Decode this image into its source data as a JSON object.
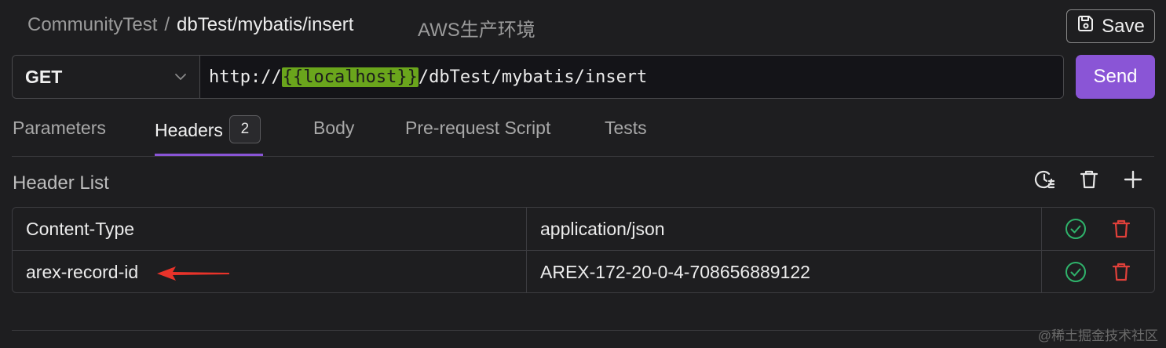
{
  "breadcrumb": {
    "workspace": "CommunityTest",
    "separator": "/",
    "path": "dbTest/mybatis/insert"
  },
  "environment": "AWS生产环境",
  "toolbar": {
    "save_label": "Save"
  },
  "request": {
    "method": "GET",
    "url_prefix": "http://",
    "url_variable": "{{localhost}}",
    "url_suffix": "/dbTest/mybatis/insert",
    "send_label": "Send"
  },
  "tabs": [
    {
      "label": "Parameters"
    },
    {
      "label": "Headers",
      "badge": "2"
    },
    {
      "label": "Body"
    },
    {
      "label": "Pre-request Script"
    },
    {
      "label": "Tests"
    }
  ],
  "active_tab": "Headers",
  "header_list": {
    "title": "Header List",
    "rows": [
      {
        "key": "Content-Type",
        "value": "application/json",
        "enabled": true
      },
      {
        "key": "arex-record-id",
        "value": "AREX-172-20-0-4-708656889122",
        "enabled": true
      }
    ]
  },
  "watermark": "@稀土掘金技术社区",
  "colors": {
    "accent": "#8a55d6",
    "variable_highlight": "#6aa51c",
    "check": "#2fb36b",
    "delete": "#e0403a",
    "annotation_arrow": "#e8332a"
  },
  "icons": {
    "save": "save-icon",
    "method_dropdown": "chevron-down-icon",
    "history": "history-icon",
    "clear": "trash-icon",
    "add": "plus-icon",
    "row_enable": "check-circle-icon",
    "row_delete": "trash-icon"
  }
}
